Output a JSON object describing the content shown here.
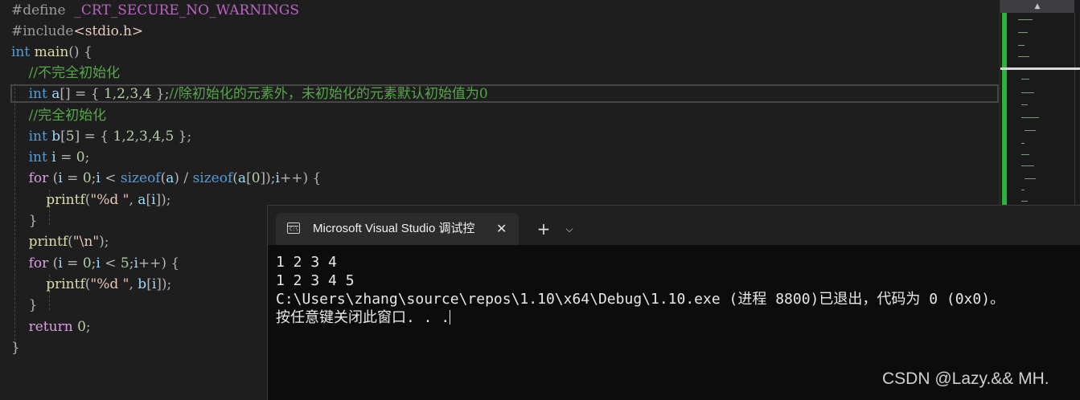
{
  "editor": {
    "lines": [
      {
        "parts": [
          [
            "pp",
            "#define  "
          ],
          [
            "macro",
            "_CRT_SECURE_NO_WARNINGS"
          ]
        ]
      },
      {
        "parts": [
          [
            "pp",
            "#include"
          ],
          [
            "str",
            "<stdio.h>"
          ]
        ]
      },
      {
        "parts": [
          [
            "kw",
            "int"
          ],
          [
            "punc",
            " "
          ],
          [
            "fn",
            "main"
          ],
          [
            "punc",
            "() {"
          ]
        ]
      },
      {
        "parts": [
          [
            "cmt",
            "    //不完全初始化"
          ]
        ]
      },
      {
        "parts": [
          [
            "punc",
            "    "
          ],
          [
            "kw",
            "int"
          ],
          [
            "punc",
            " "
          ],
          [
            "var",
            "a"
          ],
          [
            "punc",
            "[] = { "
          ],
          [
            "num",
            "1"
          ],
          [
            "punc",
            ","
          ],
          [
            "num",
            "2"
          ],
          [
            "punc",
            ","
          ],
          [
            "num",
            "3"
          ],
          [
            "punc",
            ","
          ],
          [
            "num",
            "4"
          ],
          [
            "punc",
            " };"
          ],
          [
            "cmt",
            "//除初始化的元素外，未初始化的元素默认初始值为0"
          ]
        ]
      },
      {
        "parts": [
          [
            "cmt",
            "    //完全初始化"
          ]
        ]
      },
      {
        "parts": [
          [
            "punc",
            "    "
          ],
          [
            "kw",
            "int"
          ],
          [
            "punc",
            " "
          ],
          [
            "var",
            "b"
          ],
          [
            "punc",
            "["
          ],
          [
            "num",
            "5"
          ],
          [
            "punc",
            "] = { "
          ],
          [
            "num",
            "1"
          ],
          [
            "punc",
            ","
          ],
          [
            "num",
            "2"
          ],
          [
            "punc",
            ","
          ],
          [
            "num",
            "3"
          ],
          [
            "punc",
            ","
          ],
          [
            "num",
            "4"
          ],
          [
            "punc",
            ","
          ],
          [
            "num",
            "5"
          ],
          [
            "punc",
            " };"
          ]
        ]
      },
      {
        "parts": [
          [
            "punc",
            "    "
          ],
          [
            "kw",
            "int"
          ],
          [
            "punc",
            " "
          ],
          [
            "var",
            "i"
          ],
          [
            "punc",
            " = "
          ],
          [
            "num",
            "0"
          ],
          [
            "punc",
            ";"
          ]
        ]
      },
      {
        "parts": [
          [
            "punc",
            "    "
          ],
          [
            "ctl",
            "for"
          ],
          [
            "punc",
            " ("
          ],
          [
            "var",
            "i"
          ],
          [
            "punc",
            " = "
          ],
          [
            "num",
            "0"
          ],
          [
            "punc",
            ";"
          ],
          [
            "var",
            "i"
          ],
          [
            "punc",
            " < "
          ],
          [
            "kw",
            "sizeof"
          ],
          [
            "punc",
            "("
          ],
          [
            "var",
            "a"
          ],
          [
            "punc",
            ") / "
          ],
          [
            "kw",
            "sizeof"
          ],
          [
            "punc",
            "("
          ],
          [
            "var",
            "a"
          ],
          [
            "punc",
            "["
          ],
          [
            "num",
            "0"
          ],
          [
            "punc",
            "]);"
          ],
          [
            "var",
            "i"
          ],
          [
            "punc",
            "++) {"
          ]
        ]
      },
      {
        "parts": [
          [
            "punc",
            "        "
          ],
          [
            "fn",
            "printf"
          ],
          [
            "punc",
            "("
          ],
          [
            "str",
            "\"%d \""
          ],
          [
            "punc",
            ", "
          ],
          [
            "var",
            "a"
          ],
          [
            "punc",
            "["
          ],
          [
            "var",
            "i"
          ],
          [
            "punc",
            "]);"
          ]
        ]
      },
      {
        "parts": [
          [
            "punc",
            "    }"
          ]
        ]
      },
      {
        "parts": [
          [
            "punc",
            "    "
          ],
          [
            "fn",
            "printf"
          ],
          [
            "punc",
            "("
          ],
          [
            "str",
            "\""
          ],
          [
            "esc",
            "\\n"
          ],
          [
            "str",
            "\""
          ],
          [
            "punc",
            ");"
          ]
        ]
      },
      {
        "parts": [
          [
            "punc",
            "    "
          ],
          [
            "ctl",
            "for"
          ],
          [
            "punc",
            " ("
          ],
          [
            "var",
            "i"
          ],
          [
            "punc",
            " = "
          ],
          [
            "num",
            "0"
          ],
          [
            "punc",
            ";"
          ],
          [
            "var",
            "i"
          ],
          [
            "punc",
            " < "
          ],
          [
            "num",
            "5"
          ],
          [
            "punc",
            ";"
          ],
          [
            "var",
            "i"
          ],
          [
            "punc",
            "++) {"
          ]
        ]
      },
      {
        "parts": [
          [
            "punc",
            "        "
          ],
          [
            "fn",
            "printf"
          ],
          [
            "punc",
            "("
          ],
          [
            "str",
            "\"%d \""
          ],
          [
            "punc",
            ", "
          ],
          [
            "var",
            "b"
          ],
          [
            "punc",
            "["
          ],
          [
            "var",
            "i"
          ],
          [
            "punc",
            "]);"
          ]
        ]
      },
      {
        "parts": [
          [
            "punc",
            "    }"
          ]
        ]
      },
      {
        "parts": [
          [
            "punc",
            "    "
          ],
          [
            "ctl",
            "return"
          ],
          [
            "punc",
            " "
          ],
          [
            "num",
            "0"
          ],
          [
            "punc",
            ";"
          ]
        ]
      },
      {
        "parts": [
          [
            "punc",
            "}"
          ]
        ]
      }
    ]
  },
  "minimap": {
    "scroll_up_glyph": "▲"
  },
  "terminal": {
    "tab_title": "Microsoft Visual Studio 调试控",
    "tab_icon_text": "C:\\",
    "close_glyph": "✕",
    "new_tab_glyph": "+",
    "dropdown_glyph": "⌵",
    "output_lines": [
      "1 2 3 4",
      "1 2 3 4 5",
      "C:\\Users\\zhang\\source\\repos\\1.10\\x64\\Debug\\1.10.exe (进程 8800)已退出，代码为 0 (0x0)。",
      "按任意键关闭此窗口. . ."
    ]
  },
  "watermark": "CSDN @Lazy.&& MH.",
  "colors": {
    "editor_bg": "#1e1e1e",
    "keyword": "#569cd6",
    "comment": "#57a64a",
    "terminal_bg": "#0c0c0c",
    "minimap_accent": "#2bb33a"
  }
}
